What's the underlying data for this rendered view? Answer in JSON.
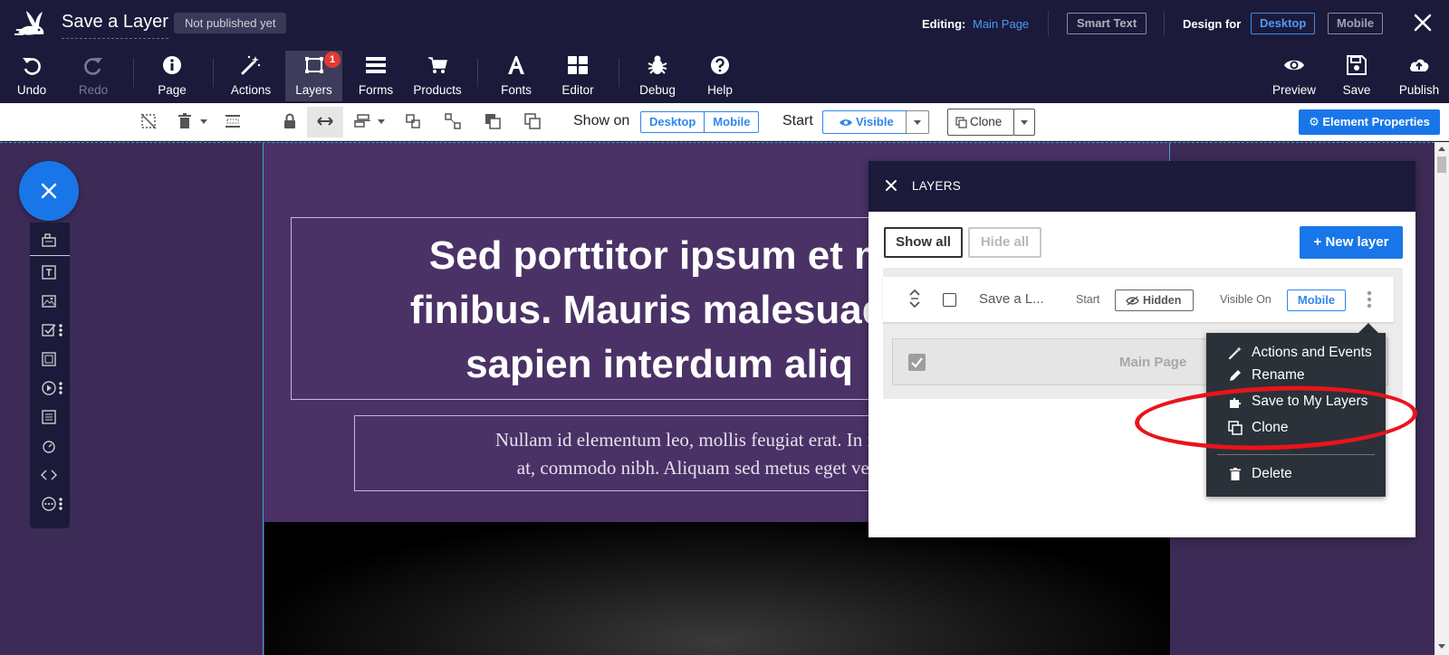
{
  "header": {
    "title": "Save a Layer",
    "publish_status": "Not published yet",
    "editing_label": "Editing:",
    "editing_page": "Main Page",
    "smart_text": "Smart Text",
    "design_for_label": "Design for",
    "design_desktop": "Desktop",
    "design_mobile": "Mobile"
  },
  "toolbar": {
    "undo": "Undo",
    "redo": "Redo",
    "page": "Page",
    "actions": "Actions",
    "layers": "Layers",
    "layers_badge": "1",
    "forms": "Forms",
    "products": "Products",
    "fonts": "Fonts",
    "editor": "Editor",
    "debug": "Debug",
    "help": "Help",
    "preview": "Preview",
    "save": "Save",
    "publish": "Publish"
  },
  "subbar": {
    "show_on_label": "Show on",
    "show_desktop": "Desktop",
    "show_mobile": "Mobile",
    "start_label": "Start",
    "visible": "Visible",
    "clone": "Clone",
    "element_properties": "Element Properties"
  },
  "canvas": {
    "headline": "Sed porttitor ipsum et m… finibus. Mauris malesuada sapien interdum aliq",
    "headline_lines": [
      "Sed porttitor ipsum et m",
      "finibus. Mauris malesuada",
      "sapien interdum aliq"
    ],
    "subtext_lines": [
      "Nullam id elementum leo, mollis feugiat erat. In id erat c",
      "at, commodo nibh. Aliquam sed metus eget velit so"
    ]
  },
  "layers_panel": {
    "title": "LAYERS",
    "show_all": "Show all",
    "hide_all": "Hide all",
    "new_layer": "New layer",
    "layer": {
      "name": "Save a L...",
      "start_label": "Start",
      "start_state": "Hidden",
      "visible_on_label": "Visible On",
      "visible_on": "Mobile"
    },
    "page_row": "Main Page"
  },
  "context_menu": {
    "items": [
      "Actions and Events",
      "Rename",
      "Save to My Layers",
      "Clone",
      "Delete"
    ]
  },
  "colors": {
    "bar_bg": "#1b1a3a",
    "accent": "#1976e8",
    "canvas_bg": "#4a3266",
    "annotation": "#e8141c"
  }
}
